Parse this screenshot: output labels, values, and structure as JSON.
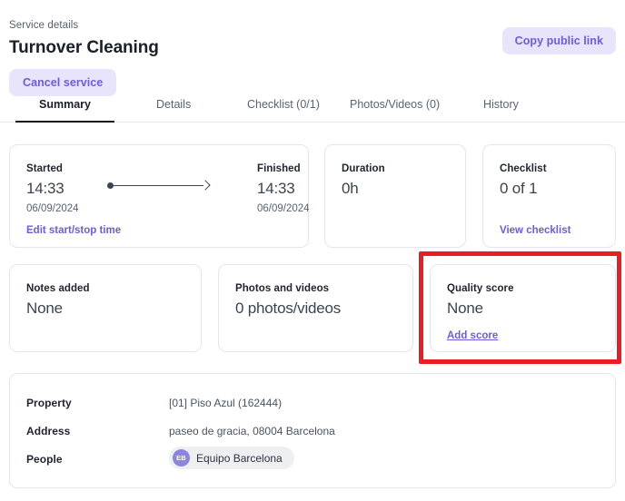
{
  "header": {
    "breadcrumb": "Service details",
    "title": "Turnover Cleaning",
    "cancel_label": "Cancel service",
    "copy_link_label": "Copy public link"
  },
  "tabs": [
    {
      "label": "Summary",
      "active": true
    },
    {
      "label": "Details",
      "active": false
    },
    {
      "label": "Checklist (0/1)",
      "active": false
    },
    {
      "label": "Photos/Videos (0)",
      "active": false
    },
    {
      "label": "History",
      "active": false
    }
  ],
  "cards": {
    "started": {
      "label": "Started",
      "value": "14:33",
      "date": "06/09/2024",
      "link": "Edit start/stop time"
    },
    "finished": {
      "label": "Finished",
      "value": "14:33",
      "date": "06/09/2024"
    },
    "duration": {
      "label": "Duration",
      "value": "0h"
    },
    "checklist": {
      "label": "Checklist",
      "value": "0 of 1",
      "link": "View checklist"
    },
    "notes": {
      "label": "Notes added",
      "value": "None"
    },
    "photos": {
      "label": "Photos and videos",
      "value": "0 photos/videos"
    },
    "quality": {
      "label": "Quality score",
      "value": "None",
      "link": "Add score"
    }
  },
  "info": {
    "property_label": "Property",
    "property_value": "[01] Piso Azul (162444)",
    "address_label": "Address",
    "address_value": "paseo de gracia, 08004 Barcelona",
    "people_label": "People",
    "person_initials": "EB",
    "person_name": "Equipo Barcelona"
  },
  "colors": {
    "accent_purple": "#6b5ce7",
    "accent_purple_bg": "#e7e4fb",
    "highlight_red": "#ed1c24",
    "avatar_bg": "#8b85e0"
  }
}
